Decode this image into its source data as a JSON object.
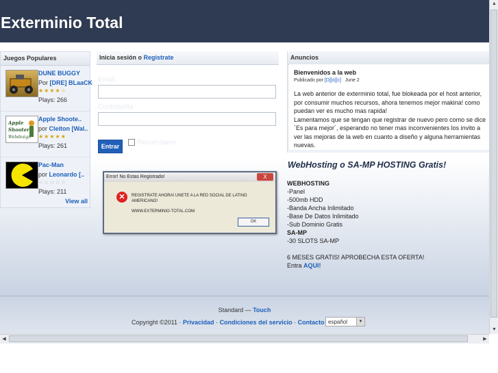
{
  "header": {
    "title": "Exterminio Total"
  },
  "games": {
    "heading": "Juegos Populares",
    "items": [
      {
        "name": "DUNE BUGGY",
        "by_prefix": "Por",
        "author": "[DRE] BLaaCK",
        "rating": 4.5,
        "plays": "Plays: 266",
        "thumb_icon": "dune-buggy-thumb"
      },
      {
        "name": "Apple Shoote..",
        "by_prefix": "por",
        "author": "Cleiton [Wal..",
        "rating": 5,
        "plays": "Plays: 261",
        "thumb_icon": "apple-shooter-thumb"
      },
      {
        "name": "Pac-Man",
        "by_prefix": "por",
        "author": "Leonardo [..",
        "rating": 0,
        "plays": "Plays: 211",
        "thumb_icon": "pacman-thumb"
      }
    ],
    "view_all": "View all"
  },
  "login": {
    "heading_prefix": "Inicia sesión o ",
    "heading_link": "Registrate",
    "email_label": "Email",
    "password_label": "Contraseña",
    "submit": "Entrar",
    "remember": "Recuérdame"
  },
  "ads": {
    "heading": "Anuncios",
    "post_title": "Bienvenidos a la web",
    "meta_prefix": "Publicado por",
    "meta_author": "[D][o][c]",
    "meta_date": "June 2",
    "body_1": "La web anterior de exterminio total, fue blokeada por el host anterior, por consumir muchos recursos, ahora tenemos mejor makina! como puedan ver es mucho mas rapida!",
    "body_2": "Lamentamos que se tengan que registrar de nuevo pero como se dice `Es para mejor´, esperando no tener mas inconvenientes los invito a ver las mejoras de la web en cuanto a diseño y alguna herramientas nuevas."
  },
  "promo": {
    "title": "WebHosting o SA-MP HOSTING Gratis!",
    "lines": [
      "WEBHOSTING",
      "-Panel",
      "-500mb HDD",
      "-Banda Ancha Inlimitado",
      "-Base De Datos Inlimitado",
      "-Sub Dominio Gratis",
      "SA-MP",
      "-30 SLOTS SA-MP",
      "",
      "6 MESES GRATIS! APROBECHA ESTA OFERTA!"
    ],
    "cta_prefix": "Entra ",
    "cta_link": "AQUI!"
  },
  "dialog": {
    "title": "Error! No Estas Registrado!",
    "close": "X",
    "message": "REGISTRATE AHORA! UNETE A LA RED SOCIAL DE LATINO AMERICANO!",
    "url": "WWW.EXTERMINIO-TOTAL.COM",
    "ok": "OK"
  },
  "footer": {
    "standard": "Standard — ",
    "touch": "Touch",
    "copyright": "Copyright ©2011 · ",
    "privacy": "Privacidad",
    "terms": "Condiciones del servicio",
    "contact": "Contacto",
    "sep": " · ",
    "language": "español"
  },
  "colors": {
    "header_bg": "#2f3b52",
    "link": "#1d5fb8",
    "button": "#2160b9"
  }
}
